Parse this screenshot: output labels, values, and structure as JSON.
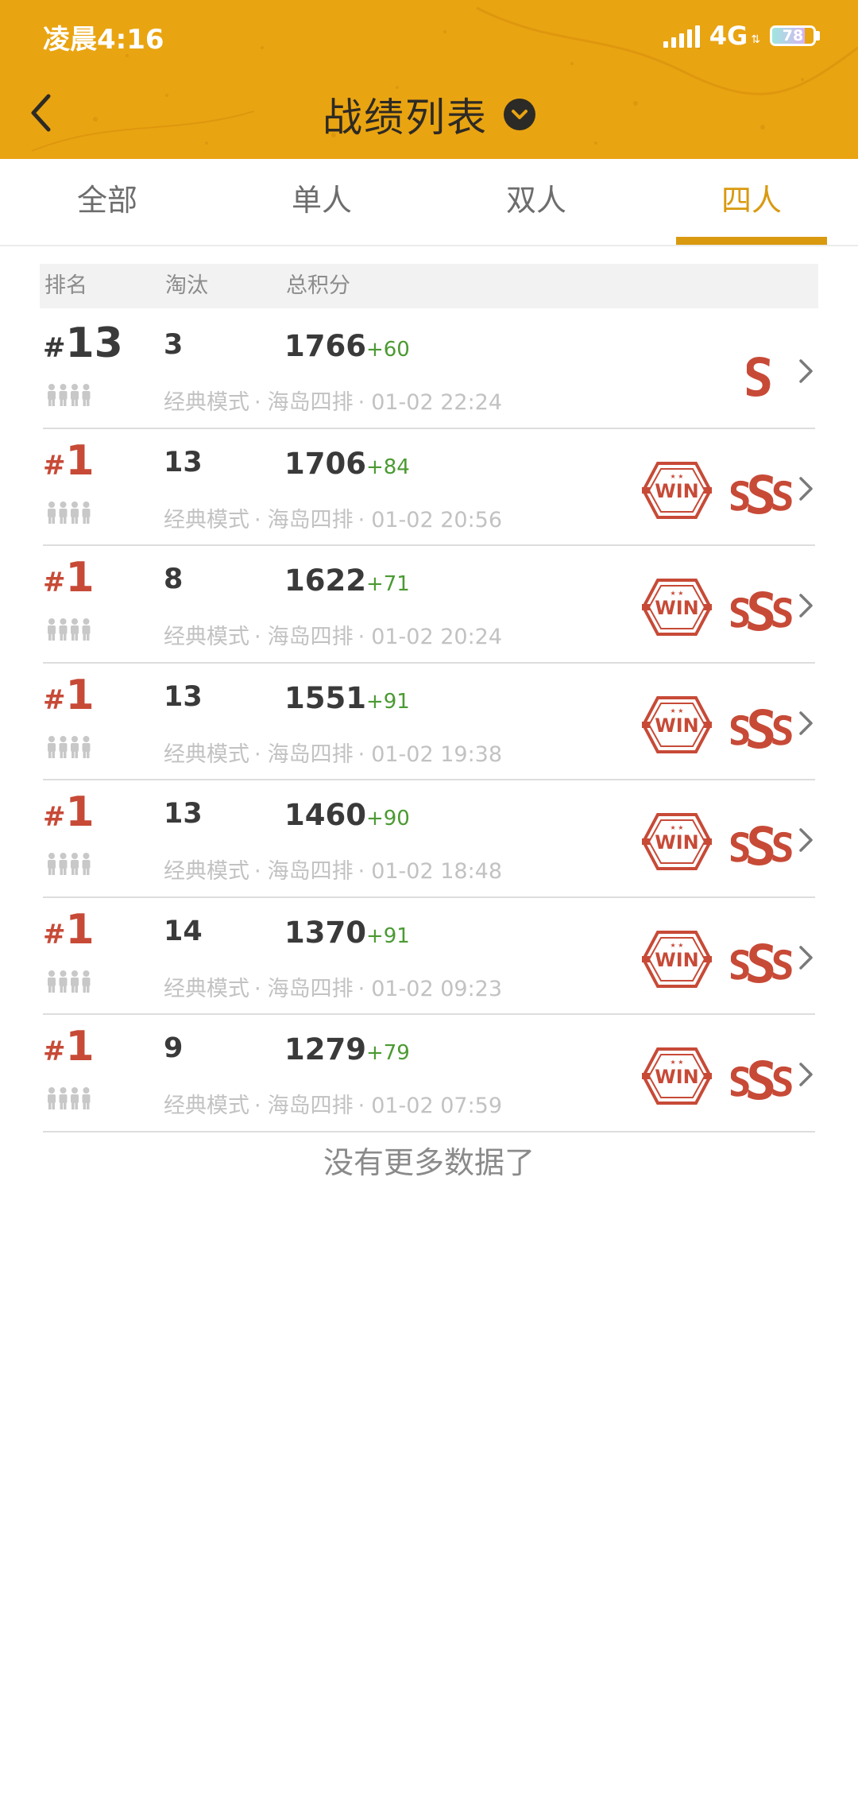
{
  "status_bar": {
    "time": "凌晨4:16",
    "network": "4G",
    "battery": "78",
    "battery_level": 0.78
  },
  "header": {
    "title": "战绩列表",
    "back_icon": "chevron-left-icon",
    "dropdown_icon": "chevron-down-circle-icon"
  },
  "colors": {
    "header_bg": "#e9a411",
    "tab_active": "#d99a10",
    "rank_win": "#c74a37",
    "score_delta": "#4b9a32",
    "badge_red": "#c74a37"
  },
  "tabs": [
    {
      "label": "全部",
      "active": false
    },
    {
      "label": "单人",
      "active": false
    },
    {
      "label": "双人",
      "active": false
    },
    {
      "label": "四人",
      "active": true
    }
  ],
  "columns": {
    "rank": "排名",
    "kills": "淘汰",
    "score": "总积分"
  },
  "records": [
    {
      "rank_hash": "#",
      "rank": "13",
      "win": false,
      "kills": "3",
      "score": "1766",
      "delta": "+60",
      "mode": "经典模式",
      "map": "海岛四排",
      "time": "01-02 22:24",
      "badges": [
        "S"
      ]
    },
    {
      "rank_hash": "#",
      "rank": "1",
      "win": true,
      "kills": "13",
      "score": "1706",
      "delta": "+84",
      "mode": "经典模式",
      "map": "海岛四排",
      "time": "01-02 20:56",
      "badges": [
        "WIN",
        "SSS"
      ]
    },
    {
      "rank_hash": "#",
      "rank": "1",
      "win": true,
      "kills": "8",
      "score": "1622",
      "delta": "+71",
      "mode": "经典模式",
      "map": "海岛四排",
      "time": "01-02 20:24",
      "badges": [
        "WIN",
        "SSS"
      ]
    },
    {
      "rank_hash": "#",
      "rank": "1",
      "win": true,
      "kills": "13",
      "score": "1551",
      "delta": "+91",
      "mode": "经典模式",
      "map": "海岛四排",
      "time": "01-02 19:38",
      "badges": [
        "WIN",
        "SSS"
      ]
    },
    {
      "rank_hash": "#",
      "rank": "1",
      "win": true,
      "kills": "13",
      "score": "1460",
      "delta": "+90",
      "mode": "经典模式",
      "map": "海岛四排",
      "time": "01-02 18:48",
      "badges": [
        "WIN",
        "SSS"
      ]
    },
    {
      "rank_hash": "#",
      "rank": "1",
      "win": true,
      "kills": "14",
      "score": "1370",
      "delta": "+91",
      "mode": "经典模式",
      "map": "海岛四排",
      "time": "01-02 09:23",
      "badges": [
        "WIN",
        "SSS"
      ]
    },
    {
      "rank_hash": "#",
      "rank": "1",
      "win": true,
      "kills": "9",
      "score": "1279",
      "delta": "+79",
      "mode": "经典模式",
      "map": "海岛四排",
      "time": "01-02 07:59",
      "badges": [
        "WIN",
        "SSS"
      ]
    }
  ],
  "footer": {
    "no_more": "没有更多数据了"
  }
}
